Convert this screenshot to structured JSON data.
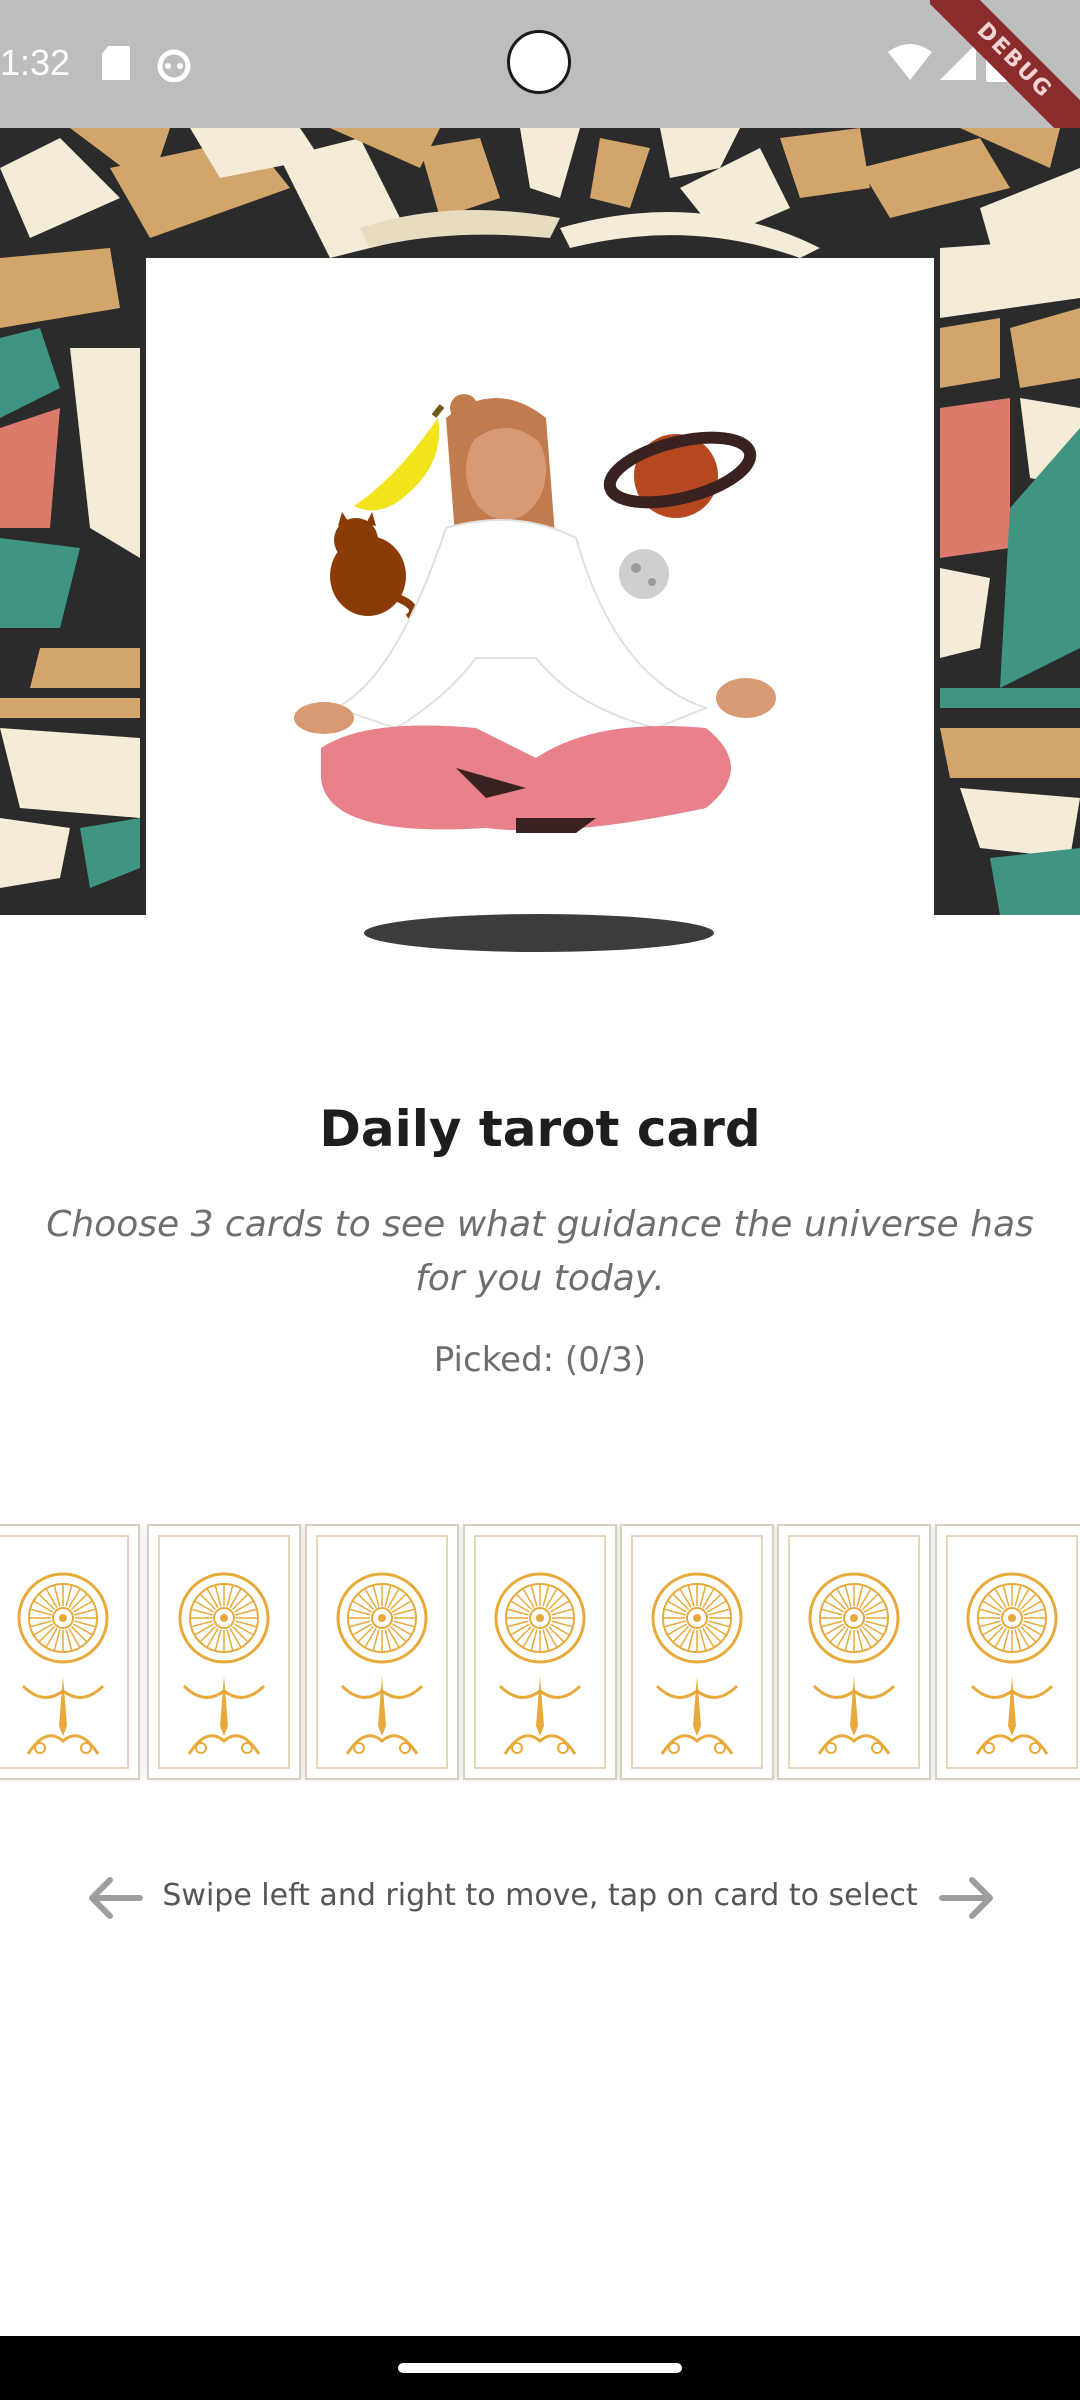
{
  "status_bar": {
    "time": "1:32",
    "icons": [
      "sd-card-icon",
      "android-icon",
      "wifi-icon",
      "signal-icon",
      "battery-icon"
    ]
  },
  "debug_banner": "DEBUG",
  "content": {
    "title": "Daily tarot card",
    "subtitle": "Choose 3 cards to see what guidance the universe has for you today.",
    "picked": "Picked: (0/3)"
  },
  "hint": {
    "text": "Swipe left and right to move, tap on card to select",
    "left_icon": "arrow-left-icon",
    "right_icon": "arrow-right-icon"
  },
  "colors": {
    "hero_bg": "#2b2b2b",
    "tan": "#d2a56a",
    "cream": "#f4ecd6",
    "coral": "#dc7a6c",
    "teal": "#3f9582",
    "card_gold": "#e7a93a",
    "status_bar": "#bdbdbd"
  }
}
